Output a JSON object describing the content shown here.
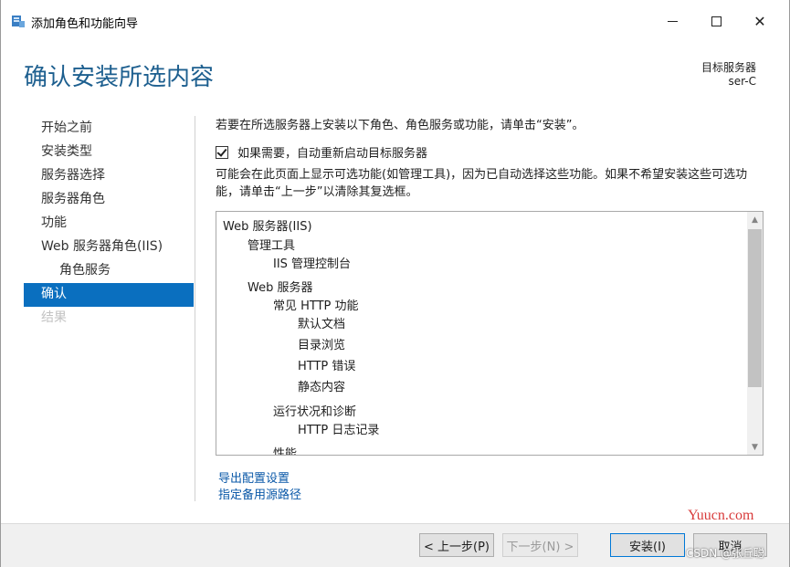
{
  "window": {
    "title": "添加角色和功能向导",
    "controls": {
      "minimize": "minimize-icon",
      "maximize": "maximize-icon",
      "close": "close-icon"
    }
  },
  "header": {
    "title": "确认安装所选内容",
    "target_label": "目标服务器",
    "target_value": "ser-C"
  },
  "nav": {
    "items": [
      {
        "label": "开始之前",
        "state": "normal"
      },
      {
        "label": "安装类型",
        "state": "normal"
      },
      {
        "label": "服务器选择",
        "state": "normal"
      },
      {
        "label": "服务器角色",
        "state": "normal"
      },
      {
        "label": "功能",
        "state": "normal"
      },
      {
        "label": "Web 服务器角色(IIS)",
        "state": "normal"
      },
      {
        "label": "角色服务",
        "state": "sub"
      },
      {
        "label": "确认",
        "state": "active"
      },
      {
        "label": "结果",
        "state": "disabled"
      }
    ]
  },
  "content": {
    "intro": "若要在所选服务器上安装以下角色、角色服务或功能，请单击“安装”。",
    "restart_checkbox": {
      "label": "如果需要，自动重新启动目标服务器",
      "checked": true
    },
    "note": "可能会在此页面上显示可选功能(如管理工具)，因为已自动选择这些功能。如果不希望安装这些可选功能，请单击“上一步”以清除其复选框。",
    "tree": [
      {
        "label": "Web 服务器(IIS)",
        "level": 0
      },
      {
        "label": "管理工具",
        "level": 1
      },
      {
        "label": "IIS 管理控制台",
        "level": 2
      },
      {
        "label": "Web 服务器",
        "level": 1
      },
      {
        "label": "常见 HTTP 功能",
        "level": 2
      },
      {
        "label": "默认文档",
        "level": 3
      },
      {
        "label": "目录浏览",
        "level": 3
      },
      {
        "label": "HTTP 错误",
        "level": 3
      },
      {
        "label": "静态内容",
        "level": 3
      },
      {
        "label": "运行状况和诊断",
        "level": 2
      },
      {
        "label": "HTTP 日志记录",
        "level": 3
      },
      {
        "label": "性能",
        "level": 2
      }
    ],
    "links": {
      "export": "导出配置设置",
      "alt_source": "指定备用源路径"
    }
  },
  "footer": {
    "prev": "< 上一步(P)",
    "next": "下一步(N) >",
    "install": "安装(I)",
    "cancel": "取消"
  },
  "watermark": {
    "site": "Yuucn.com",
    "credit": "CSDN @张丘聪"
  }
}
